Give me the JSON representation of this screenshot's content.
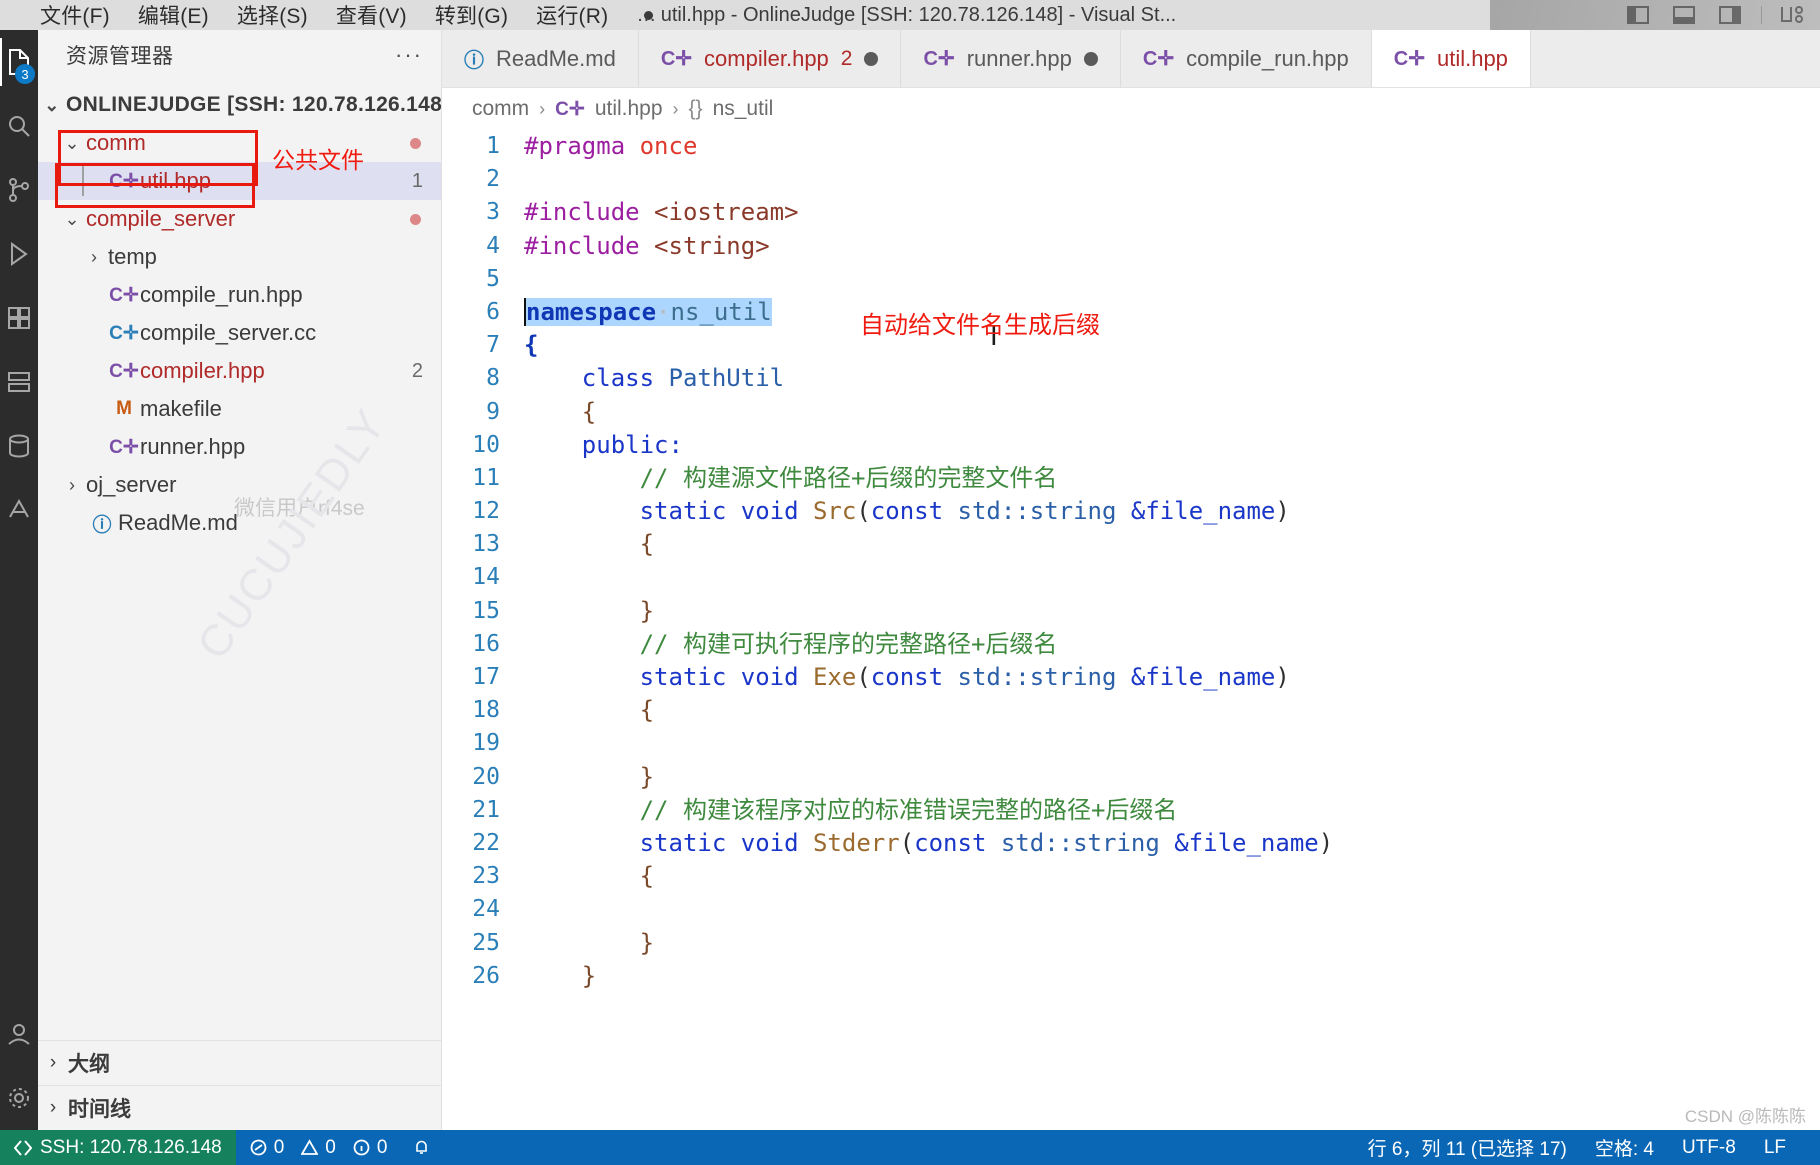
{
  "titlebar": {
    "menus": [
      "文件(F)",
      "编辑(E)",
      "选择(S)",
      "查看(V)",
      "转到(G)",
      "运行(R)"
    ],
    "more": "…",
    "dirty_marker": "●",
    "window_title": "util.hpp - OnlineJudge [SSH: 120.78.126.148] - Visual St...",
    "layout_icons": [
      "panel-left-icon",
      "panel-bottom-icon",
      "panel-right-icon",
      "customize-layout-icon"
    ]
  },
  "activitybar": {
    "items": [
      {
        "name": "explorer-icon",
        "glyph": "🗎",
        "badge": "3",
        "active": true
      },
      {
        "name": "search-icon",
        "glyph": "⌕",
        "badge": "",
        "active": false
      },
      {
        "name": "source-control-icon",
        "glyph": "⑂",
        "badge": "",
        "active": false
      },
      {
        "name": "run-debug-icon",
        "glyph": "▷",
        "badge": "",
        "active": false
      },
      {
        "name": "extensions-icon",
        "glyph": "❏",
        "badge": "",
        "active": false
      },
      {
        "name": "remote-explorer-icon",
        "glyph": "🖧",
        "badge": "",
        "active": false
      },
      {
        "name": "database-icon",
        "glyph": "🗄",
        "badge": "",
        "active": false
      },
      {
        "name": "testing-icon",
        "glyph": "⚗",
        "badge": "",
        "active": false
      },
      {
        "name": "account-icon",
        "glyph": "☻",
        "badge": "",
        "active": false
      },
      {
        "name": "settings-gear-icon",
        "glyph": "⚙",
        "badge": "",
        "active": false
      }
    ]
  },
  "sidebar": {
    "title": "资源管理器",
    "more_actions": "···",
    "root": {
      "label": "ONLINEJUDGE [SSH: 120.78.126.148]",
      "expanded": true
    },
    "tree": [
      {
        "label": "comm",
        "type": "folder",
        "expanded": true,
        "indent": 1,
        "color": "red",
        "modified": true,
        "badge": ""
      },
      {
        "label": "util.hpp",
        "type": "cpp",
        "indent": 2,
        "color": "red",
        "selected": true,
        "badge": "1"
      },
      {
        "label": "compile_server",
        "type": "folder",
        "expanded": true,
        "indent": 1,
        "color": "red",
        "modified": true,
        "badge": ""
      },
      {
        "label": "temp",
        "type": "folder",
        "expanded": false,
        "indent": 2,
        "color": "gray",
        "badge": ""
      },
      {
        "label": "compile_run.hpp",
        "type": "cpp",
        "indent": 2,
        "color": "gray",
        "badge": ""
      },
      {
        "label": "compile_server.cc",
        "type": "cc",
        "indent": 2,
        "color": "gray",
        "badge": ""
      },
      {
        "label": "compiler.hpp",
        "type": "cpp",
        "indent": 2,
        "color": "red",
        "badge": "2"
      },
      {
        "label": "makefile",
        "type": "makefile",
        "indent": 2,
        "color": "gray",
        "badge": ""
      },
      {
        "label": "runner.hpp",
        "type": "cpp",
        "indent": 2,
        "color": "gray",
        "badge": ""
      },
      {
        "label": "oj_server",
        "type": "folder",
        "expanded": false,
        "indent": 1,
        "color": "gray",
        "badge": ""
      },
      {
        "label": "ReadMe.md",
        "type": "md",
        "indent": 1,
        "color": "gray",
        "badge": ""
      }
    ],
    "panels": [
      {
        "label": "大纲",
        "expanded": false
      },
      {
        "label": "时间线",
        "expanded": false
      }
    ],
    "watermark_user": "微信用户rf4se",
    "watermark_diagonal": "CUCUJIEDLY"
  },
  "annotations": {
    "callout_text": "公共文件",
    "editor_note": "自动给文件名生成后缀",
    "color": "#f01b10"
  },
  "editor": {
    "tabs": [
      {
        "label": "ReadMe.md",
        "icon": "info-icon",
        "icon_color": "#2b7fb8",
        "error_count": "",
        "dirty": false,
        "active": false,
        "error": false
      },
      {
        "label": "compiler.hpp",
        "icon": "cpp-icon",
        "icon_color": "#7b4fa8",
        "error_count": "2",
        "dirty": true,
        "active": false,
        "error": true
      },
      {
        "label": "runner.hpp",
        "icon": "cpp-icon",
        "icon_color": "#7b4fa8",
        "error_count": "",
        "dirty": true,
        "active": false,
        "error": false
      },
      {
        "label": "compile_run.hpp",
        "icon": "cpp-icon",
        "icon_color": "#7b4fa8",
        "error_count": "",
        "dirty": false,
        "active": false,
        "error": false
      },
      {
        "label": "util.hpp",
        "icon": "cpp-icon",
        "icon_color": "#7b4fa8",
        "error_count": "",
        "dirty": false,
        "active": true,
        "error": true
      }
    ],
    "breadcrumb": [
      "comm",
      "util.hpp",
      "ns_util"
    ],
    "breadcrumb_symbol": "{}",
    "selection_text": "namespace ns_util",
    "lines": [
      {
        "n": "1",
        "tokens": [
          {
            "t": "#pragma ",
            "c": "k-pre"
          },
          {
            "t": "once",
            "c": "k-once"
          }
        ]
      },
      {
        "n": "2",
        "tokens": []
      },
      {
        "n": "3",
        "tokens": [
          {
            "t": "#include ",
            "c": "k-pre"
          },
          {
            "t": "<iostream>",
            "c": "k-str"
          }
        ]
      },
      {
        "n": "4",
        "tokens": [
          {
            "t": "#include ",
            "c": "k-pre"
          },
          {
            "t": "<string>",
            "c": "k-str"
          }
        ]
      },
      {
        "n": "5",
        "tokens": []
      },
      {
        "n": "6",
        "selected": true,
        "tokens": [
          {
            "t": "namespace",
            "c": "k-ns sel"
          },
          {
            "t": "·",
            "c": "mdot sel"
          },
          {
            "t": "ns_util",
            "c": "k-id sel"
          }
        ]
      },
      {
        "n": "7",
        "tokens": [
          {
            "t": "{",
            "c": "k-ns"
          }
        ]
      },
      {
        "n": "8",
        "tokens": [
          {
            "t": "    class ",
            "c": "k-kw"
          },
          {
            "t": "PathUtil",
            "c": "k-type"
          }
        ]
      },
      {
        "n": "9",
        "tokens": [
          {
            "t": "    {",
            "c": "k-brace"
          }
        ]
      },
      {
        "n": "10",
        "tokens": [
          {
            "t": "    public:",
            "c": "k-kw"
          }
        ]
      },
      {
        "n": "11",
        "tokens": [
          {
            "t": "        // 构建源文件路径+后缀的完整文件名",
            "c": "k-cmt"
          }
        ]
      },
      {
        "n": "12",
        "tokens": [
          {
            "t": "        static void ",
            "c": "k-kw"
          },
          {
            "t": "Src",
            "c": "k-fn"
          },
          {
            "t": "(",
            "c": "k-punct"
          },
          {
            "t": "const ",
            "c": "k-kw"
          },
          {
            "t": "std::string ",
            "c": "k-type"
          },
          {
            "t": "&file_name",
            "c": "k-kw"
          },
          {
            "t": ")",
            "c": "k-punct"
          }
        ]
      },
      {
        "n": "13",
        "tokens": [
          {
            "t": "        {",
            "c": "k-brace"
          }
        ]
      },
      {
        "n": "14",
        "tokens": []
      },
      {
        "n": "15",
        "tokens": [
          {
            "t": "        }",
            "c": "k-brace"
          }
        ]
      },
      {
        "n": "16",
        "tokens": [
          {
            "t": "        // 构建可执行程序的完整路径+后缀名",
            "c": "k-cmt"
          }
        ]
      },
      {
        "n": "17",
        "tokens": [
          {
            "t": "        static void ",
            "c": "k-kw"
          },
          {
            "t": "Exe",
            "c": "k-fn"
          },
          {
            "t": "(",
            "c": "k-punct"
          },
          {
            "t": "const ",
            "c": "k-kw"
          },
          {
            "t": "std::string ",
            "c": "k-type"
          },
          {
            "t": "&file_name",
            "c": "k-kw"
          },
          {
            "t": ")",
            "c": "k-punct"
          }
        ]
      },
      {
        "n": "18",
        "tokens": [
          {
            "t": "        {",
            "c": "k-brace"
          }
        ]
      },
      {
        "n": "19",
        "tokens": []
      },
      {
        "n": "20",
        "tokens": [
          {
            "t": "        }",
            "c": "k-brace"
          }
        ]
      },
      {
        "n": "21",
        "tokens": [
          {
            "t": "        // 构建该程序对应的标准错误完整的路径+后缀名",
            "c": "k-cmt"
          }
        ]
      },
      {
        "n": "22",
        "tokens": [
          {
            "t": "        static void ",
            "c": "k-kw"
          },
          {
            "t": "Stderr",
            "c": "k-fn"
          },
          {
            "t": "(",
            "c": "k-punct"
          },
          {
            "t": "const ",
            "c": "k-kw"
          },
          {
            "t": "std::string ",
            "c": "k-type"
          },
          {
            "t": "&file_name",
            "c": "k-kw"
          },
          {
            "t": ")",
            "c": "k-punct"
          }
        ]
      },
      {
        "n": "23",
        "tokens": [
          {
            "t": "        {",
            "c": "k-brace"
          }
        ]
      },
      {
        "n": "24",
        "tokens": []
      },
      {
        "n": "25",
        "tokens": [
          {
            "t": "        }",
            "c": "k-brace"
          }
        ]
      },
      {
        "n": "26",
        "tokens": [
          {
            "t": "    }",
            "c": "k-brace"
          }
        ]
      }
    ]
  },
  "statusbar": {
    "remote": "SSH: 120.78.126.148",
    "problems_errors": "0",
    "problems_warnings": "0",
    "problems_info": "0",
    "position": "行 6，列 11 (已选择 17)",
    "spaces": "空格: 4",
    "encoding": "UTF-8",
    "eol": "LF"
  },
  "csdn_watermark": "CSDN @陈陈陈"
}
